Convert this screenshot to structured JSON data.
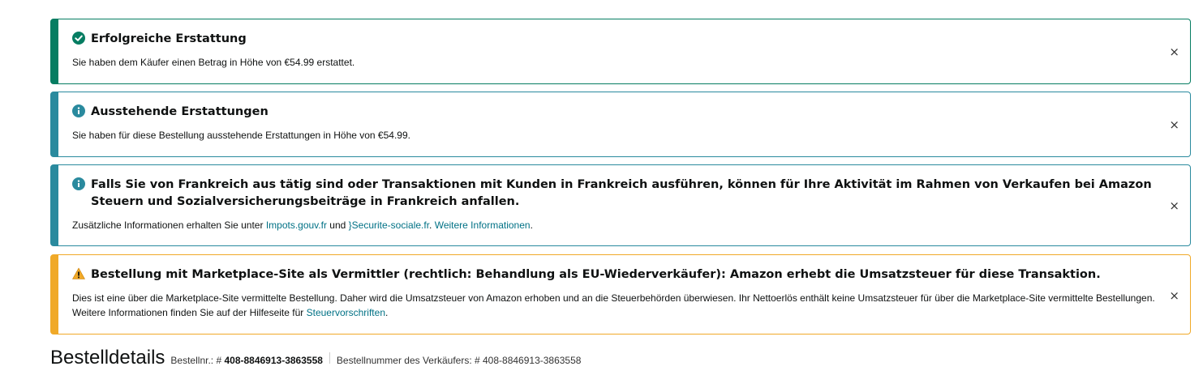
{
  "alerts": {
    "refund_success": {
      "title": "Erfolgreiche Erstattung",
      "body": "Sie haben dem Käufer einen Betrag in Höhe von €54.99 erstattet."
    },
    "pending_refunds": {
      "title": "Ausstehende Erstattungen",
      "body": "Sie haben für diese Bestellung ausstehende Erstattungen in Höhe von €54.99."
    },
    "france_tax": {
      "title": "Falls Sie von Frankreich aus tätig sind oder Transaktionen mit Kunden in Frankreich ausführen, können für Ihre Aktivität im Rahmen von Verkaufen bei Amazon Steuern und Sozialversicherungsbeiträge in Frankreich anfallen.",
      "body_prefix": "Zusätzliche Informationen erhalten Sie unter ",
      "link1": "Impots.gouv.fr",
      "body_mid": " und ",
      "link2": "}Securite-sociale.fr",
      "body_dot": ". ",
      "link3": "Weitere Informationen",
      "body_end": "."
    },
    "marketplace_vat": {
      "title": "Bestellung mit Marketplace-Site als Vermittler (rechtlich: Behandlung als EU-Wiederverkäufer): Amazon erhebt die Umsatzsteuer für diese Transaktion.",
      "body_prefix": "Dies ist eine über die Marketplace-Site vermittelte Bestellung. Daher wird die Umsatzsteuer von Amazon erhoben und an die Steuerbehörden überwiesen. Ihr Nettoerlös enthält keine Umsatzsteuer für über die Marketplace-Site vermittelte Bestellungen. Weitere Informationen finden Sie auf der Hilfeseite für ",
      "link": "Steuervorschriften",
      "body_end": "."
    },
    "close_glyph": "×"
  },
  "order_details": {
    "title": "Bestelldetails",
    "order_no_label": "Bestellnr.: # ",
    "order_no": "408-8846913-3863558",
    "seller_order_label": "Bestellnummer des Verkäufers: # 408-8846913-3863558"
  },
  "colors": {
    "success": "#067d62",
    "info": "#2a8a9e",
    "warning": "#f0a928",
    "link": "#007185"
  },
  "icons": {
    "success": "check-circle-icon",
    "info": "info-circle-icon",
    "warning": "warning-triangle-icon"
  }
}
